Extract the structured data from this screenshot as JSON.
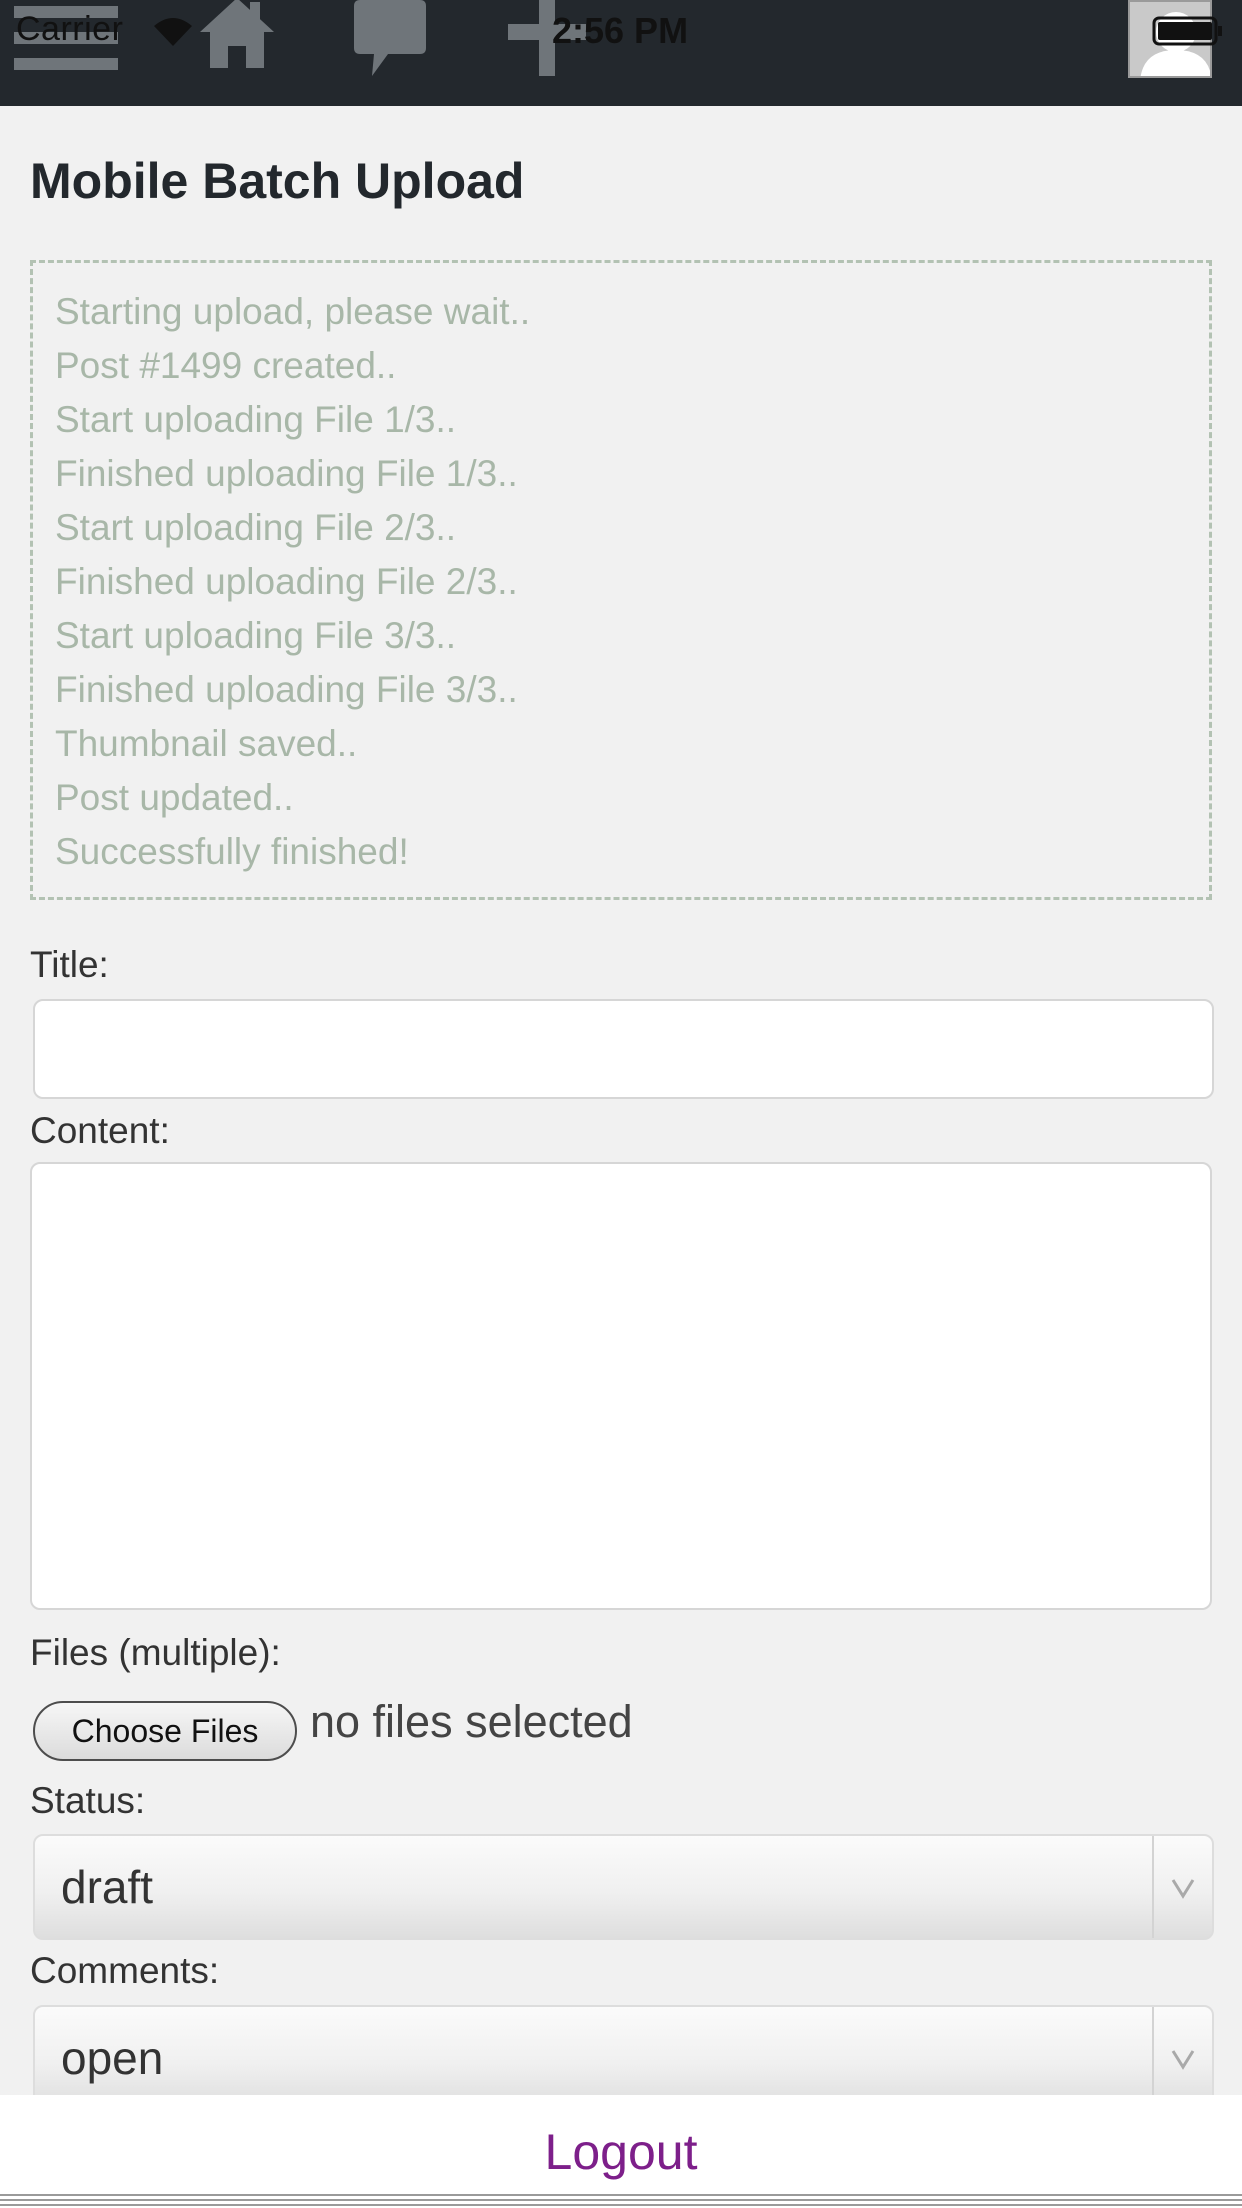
{
  "status_bar": {
    "carrier": "Carrier",
    "time": "2:56 PM",
    "wifi_icon": "wifi-icon",
    "battery_icon": "battery-icon"
  },
  "toolbar": {
    "icons": [
      "menu-icon",
      "home-icon",
      "comment-icon",
      "plus-icon",
      "avatar"
    ]
  },
  "page": {
    "title": "Mobile Batch Upload"
  },
  "upload_log": [
    "Starting upload, please wait..",
    "Post #1499 created..",
    "Start uploading File 1/3..",
    "Finished uploading File 1/3..",
    "Start uploading File 2/3..",
    "Finished uploading File 2/3..",
    "Start uploading File 3/3..",
    "Finished uploading File 3/3..",
    "Thumbnail saved..",
    "Post updated..",
    "Successfully finished!"
  ],
  "form": {
    "title_label": "Title:",
    "title_value": "",
    "content_label": "Content:",
    "content_value": "",
    "files_label": "Files (multiple):",
    "choose_files_label": "Choose Files",
    "no_files_text": "no files selected",
    "status_label": "Status:",
    "status_value": "draft",
    "comments_label": "Comments:",
    "comments_value": "open"
  },
  "footer": {
    "logout_label": "Logout"
  },
  "colors": {
    "topbar": "#23282d",
    "background": "#f1f1f1",
    "log_text": "#a8b7a8",
    "logout_link": "#7d1f8a"
  }
}
